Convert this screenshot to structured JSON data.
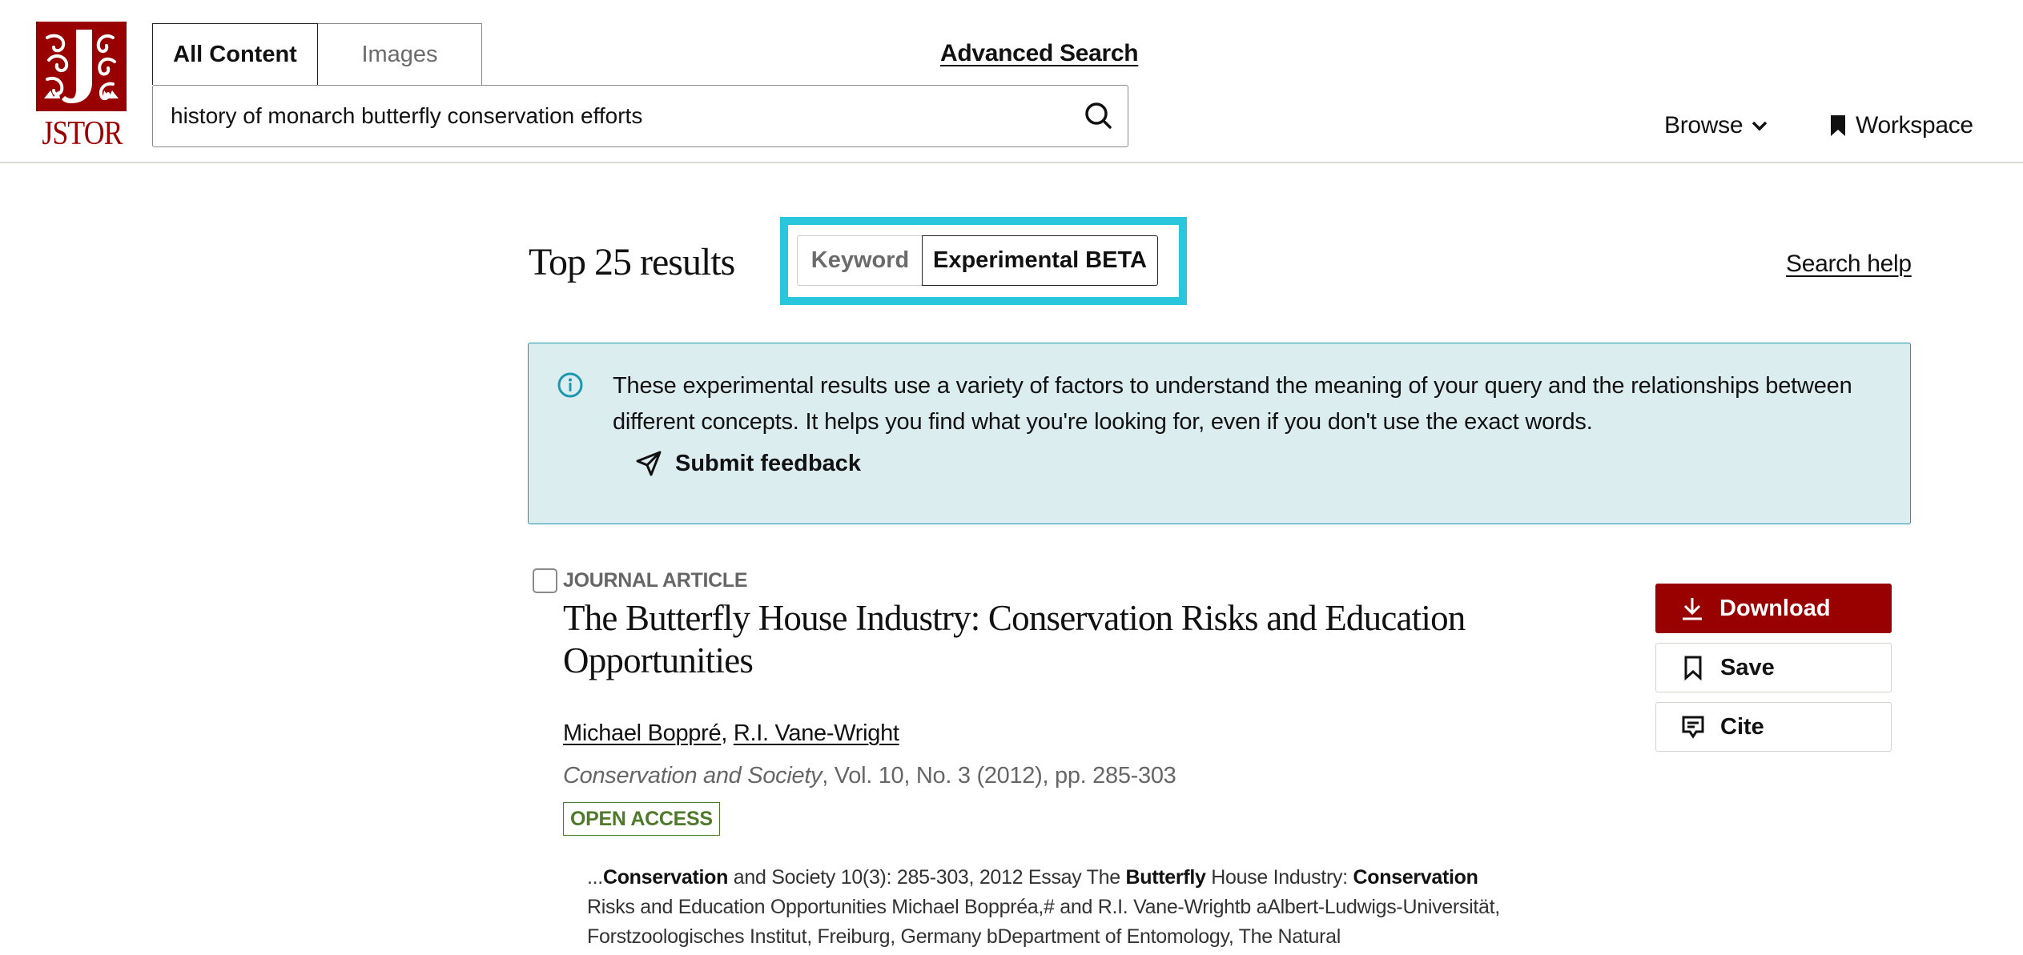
{
  "header": {
    "logo_text": "JSTOR",
    "tabs": [
      {
        "label": "All Content",
        "active": true
      },
      {
        "label": "Images",
        "active": false
      }
    ],
    "search": {
      "value": "history of monarch butterfly conservation efforts",
      "icon": "search-icon"
    },
    "advanced_search": "Advanced Search",
    "nav": {
      "browse": "Browse",
      "workspace": "Workspace"
    }
  },
  "results_header": {
    "title": "Top 25 results",
    "mode_toggle": [
      {
        "label": "Keyword",
        "active": false
      },
      {
        "label": "Experimental BETA",
        "active": true
      }
    ],
    "search_help": "Search help"
  },
  "banner": {
    "icon": "info-icon",
    "text": "These experimental results use a variety of factors to understand the meaning of your query and the relationships between different concepts. It helps you find what you're looking for, even if you don't use the exact words.",
    "feedback_label": "Submit feedback"
  },
  "colors": {
    "brand_red": "#990000",
    "highlight_cyan": "#29c6de",
    "banner_bg": "#dcedf0",
    "banner_border": "#1b97ae",
    "open_access_green": "#4e7a2a"
  },
  "results": [
    {
      "content_type": "JOURNAL ARTICLE",
      "title": "The Butterfly House Industry: Conservation Risks and Education Opportunities",
      "authors": [
        "Michael Boppré",
        "R.I. Vane-Wright"
      ],
      "author_separator": ", ",
      "journal": "Conservation and Society",
      "citation": ", Vol. 10, No. 3 (2012), pp. 285-303",
      "badge": "OPEN ACCESS",
      "snippet": [
        {
          "text": "...",
          "bold": false
        },
        {
          "text": "Conservation",
          "bold": true
        },
        {
          "text": " and Society 10(3): 285-303, 2012 Essay The ",
          "bold": false
        },
        {
          "text": "Butterfly",
          "bold": true
        },
        {
          "text": " House Industry: ",
          "bold": false
        },
        {
          "text": "Conservation",
          "bold": true
        },
        {
          "text": " Risks and Education Opportunities Michael Boppréa,# and R.I. Vane-Wrightb aAlbert-Ludwigs-Universität, Forstzoologisches Institut, Freiburg, Germany bDepartment of Entomology, The Natural",
          "bold": false
        }
      ],
      "actions": {
        "download": "Download",
        "save": "Save",
        "cite": "Cite"
      }
    }
  ]
}
